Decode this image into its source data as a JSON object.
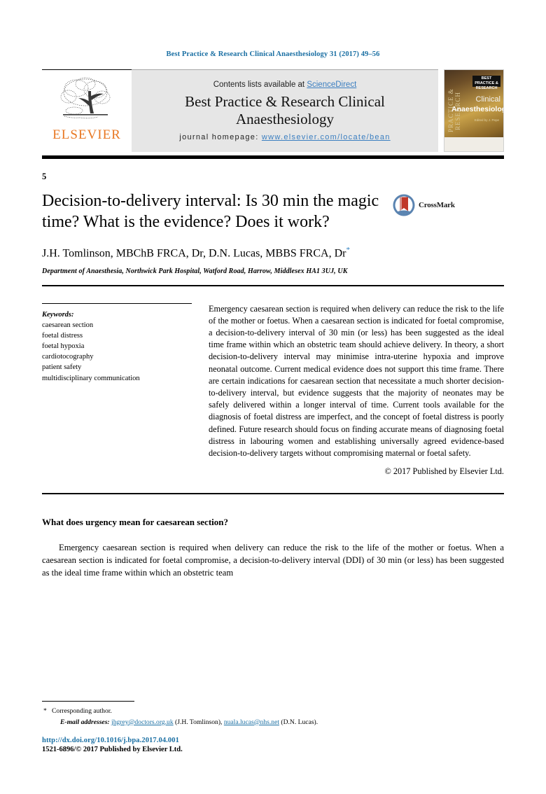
{
  "running_head": "Best Practice & Research Clinical Anaesthesiology 31 (2017) 49–56",
  "header": {
    "publisher_name": "ELSEVIER",
    "publisher_logo_icon": "elsevier-tree-icon",
    "contents_prefix": "Contents lists available at ",
    "contents_link": "ScienceDirect",
    "journal_title_line1": "Best Practice & Research Clinical",
    "journal_title_line2": "Anaesthesiology",
    "homepage_label": "journal homepage: ",
    "homepage_url": "www.elsevier.com/locate/bean",
    "cover": {
      "spine_text": "PRACTICE & RESEARCH",
      "badge_text": "BEST PRACTICE & RESEARCH",
      "title_line1": "Clinical",
      "title_line2": "Anaesthesiology",
      "subtitle": "Edited by\nJ. Pepe"
    }
  },
  "article": {
    "number": "5",
    "title": "Decision-to-delivery interval: Is 30 min the magic time? What is the evidence? Does it work?",
    "crossmark_label": "CrossMark",
    "crossmark_icon": "crossmark-icon",
    "authors": "J.H. Tomlinson, MBChB FRCA, Dr, D.N. Lucas, MBBS FRCA, Dr",
    "author_marker": "*",
    "affiliation": "Department of Anaesthesia, Northwick Park Hospital, Watford Road, Harrow, Middlesex HA1 3UJ, UK"
  },
  "keywords": {
    "heading": "Keywords:",
    "items": [
      "caesarean section",
      "foetal distress",
      "foetal hypoxia",
      "cardiotocography",
      "patient safety",
      "multidisciplinary communication"
    ]
  },
  "abstract": {
    "text": "Emergency caesarean section is required when delivery can reduce the risk to the life of the mother or foetus. When a caesarean section is indicated for foetal compromise, a decision-to-delivery interval of 30 min (or less) has been suggested as the ideal time frame within which an obstetric team should achieve delivery. In theory, a short decision-to-delivery interval may minimise intra-uterine hypoxia and improve neonatal outcome. Current medical evidence does not support this time frame. There are certain indications for caesarean section that necessitate a much shorter decision-to-delivery interval, but evidence suggests that the majority of neonates may be safely delivered within a longer interval of time. Current tools available for the diagnosis of foetal distress are imperfect, and the concept of foetal distress is poorly defined. Future research should focus on finding accurate means of diagnosing foetal distress in labouring women and establishing universally agreed evidence-based decision-to-delivery targets without compromising maternal or foetal safety.",
    "copyright": "© 2017 Published by Elsevier Ltd."
  },
  "body": {
    "section_heading": "What does urgency mean for caesarean section?",
    "paragraph": "Emergency caesarean section is required when delivery can reduce the risk to the life of the mother or foetus. When a caesarean section is indicated for foetal compromise, a decision-to-delivery interval (DDI) of 30 min (or less) has been suggested as the ideal time frame within which an obstetric team"
  },
  "footer": {
    "corresponding_marker": "*",
    "corresponding_author": "Corresponding author.",
    "email_label": "E-mail addresses:",
    "email1": "jhgrey@doctors.org.uk",
    "email1_name": "(J.H. Tomlinson),",
    "email2": "nuala.lucas@nhs.net",
    "email2_name": "(D.N. Lucas).",
    "doi": "http://dx.doi.org/10.1016/j.bpa.2017.04.001",
    "issn": "1521-6896/© 2017 Published by Elsevier Ltd."
  },
  "colors": {
    "link_blue": "#1a6fa3",
    "elsevier_orange": "#E87722",
    "header_band_gray": "#e6e6e6"
  }
}
